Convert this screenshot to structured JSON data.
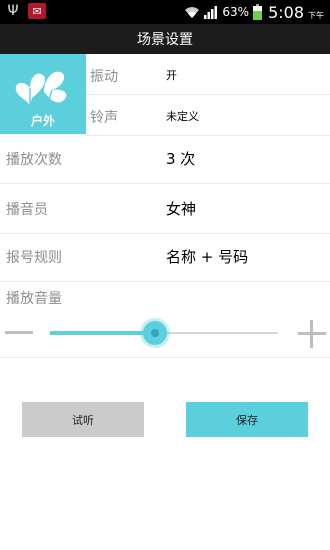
{
  "status": {
    "battery": "63%",
    "time": "5:08",
    "ampm": "下午"
  },
  "header": {
    "title": "场景设置"
  },
  "scene": {
    "label": "户外",
    "icon": "butterfly-icon"
  },
  "settings": {
    "vibrate": {
      "label": "振动",
      "value": "开"
    },
    "ringtone": {
      "label": "铃声",
      "value": "未定义"
    },
    "play_count": {
      "label": "播放次数",
      "value": "3 次"
    },
    "announcer": {
      "label": "播音员",
      "value": "女神"
    },
    "number_rule": {
      "label": "报号规则",
      "value": "名称 + 号码"
    },
    "volume": {
      "label": "播放音量",
      "level": 0.46
    }
  },
  "actions": {
    "listen": "试听",
    "save": "保存"
  },
  "colors": {
    "accent": "#5ccfdd",
    "titlebar": "#1c1c1c",
    "button_gray": "#cbcbcb"
  }
}
